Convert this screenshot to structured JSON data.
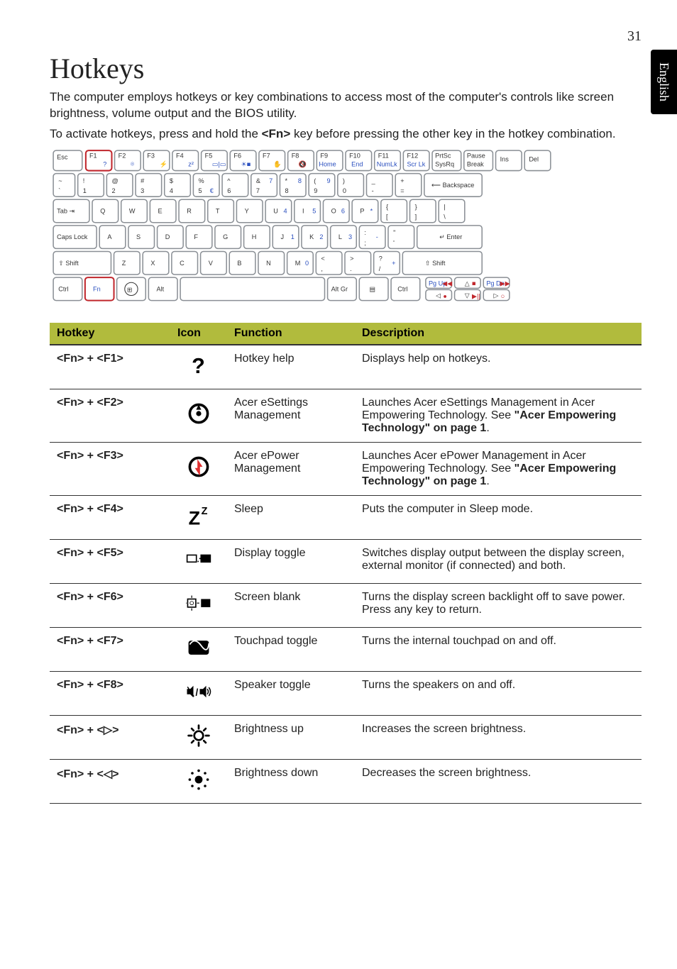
{
  "page_number": "31",
  "side_tab": "English",
  "title": "Hotkeys",
  "intro_p1_a": "The computer employs hotkeys or key combinations to access most of the computer's controls like screen brightness, volume output and the BIOS utility.",
  "intro_p2_a": "To activate hotkeys, press and hold the ",
  "intro_p2_key": "<Fn>",
  "intro_p2_b": " key before pressing the other key in the hotkey combination.",
  "table": {
    "headers": {
      "hotkey": "Hotkey",
      "icon": "Icon",
      "func": "Function",
      "desc": "Description"
    },
    "rows": [
      {
        "hotkey": "<Fn> + <F1>",
        "icon": "help",
        "func": "Hotkey help",
        "desc": "Displays help on hotkeys."
      },
      {
        "hotkey": "<Fn> + <F2>",
        "icon": "esettings",
        "func": "Acer eSettings Management",
        "desc_a": "Launches Acer eSettings Management in Acer Empowering Technology. See ",
        "desc_link": "\"Acer Empowering Technology\" on page 1",
        "desc_b": "."
      },
      {
        "hotkey": "<Fn> + <F3>",
        "icon": "epower",
        "func": "Acer ePower Management",
        "desc_a": "Launches Acer ePower Management in Acer Empowering Technology. See ",
        "desc_link": "\"Acer Empowering Technology\" on page 1",
        "desc_b": "."
      },
      {
        "hotkey": "<Fn> + <F4>",
        "icon": "sleep",
        "func": "Sleep",
        "desc": "Puts the computer in Sleep mode."
      },
      {
        "hotkey": "<Fn> + <F5>",
        "icon": "display",
        "func": "Display toggle",
        "desc": "Switches display output between the display screen, external monitor (if connected) and both."
      },
      {
        "hotkey": "<Fn> + <F6>",
        "icon": "blank",
        "func": "Screen blank",
        "desc": "Turns the display screen backlight off to save power. Press any key to return."
      },
      {
        "hotkey": "<Fn> + <F7>",
        "icon": "touchpad",
        "func": "Touchpad toggle",
        "desc": "Turns the internal touchpad on and off."
      },
      {
        "hotkey": "<Fn> + <F8>",
        "icon": "speaker",
        "func": "Speaker toggle",
        "desc": "Turns the speakers on and off."
      },
      {
        "hotkey": "<Fn> + <▷>",
        "icon": "brightup",
        "func": "Brightness up",
        "desc": "Increases the screen brightness."
      },
      {
        "hotkey": "<Fn> + <◁>",
        "icon": "brightdown",
        "func": "Brightness down",
        "desc": "Decreases the screen brightness."
      }
    ]
  }
}
